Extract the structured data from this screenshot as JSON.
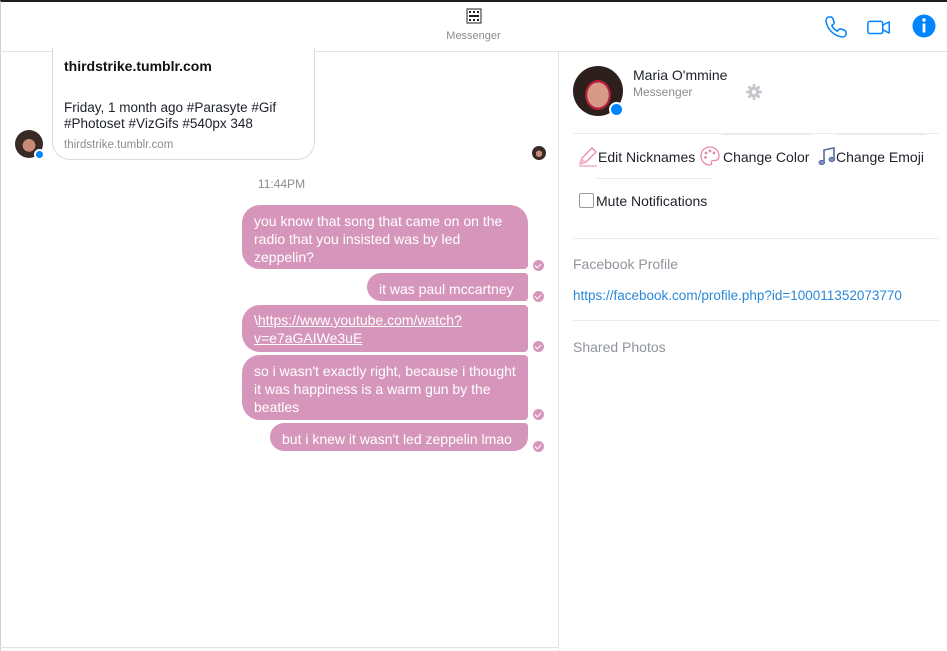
{
  "header": {
    "title": "Messenger",
    "title_icon": "gif-icon",
    "buttons": [
      {
        "name": "call",
        "icon": "phone-icon"
      },
      {
        "name": "video",
        "icon": "video-camera-icon"
      },
      {
        "name": "info",
        "icon": "info-icon"
      }
    ],
    "accent_color": "#0084ff"
  },
  "conversation": {
    "link_preview": {
      "title": "thirdstrike.tumblr.com",
      "description": "Friday, 1 month ago #Parasyte #Gif #Photoset #VizGifs #540px 348",
      "domain": "thirdstrike.tumblr.com"
    },
    "timestamp": "11:44PM",
    "bubble_color": "#d696bb",
    "messages": [
      {
        "text": "you know that song that came on on the radio that you insisted was by led zeppelin?"
      },
      {
        "text": "it was paul mccartney"
      },
      {
        "prefix": "\\",
        "link": "https://www.youtube.com/watch?v=e7aGAIWe3uE"
      },
      {
        "text": "so i wasn't exactly right, because i thought it was happiness is a warm gun by the beatles"
      },
      {
        "text": "but i knew it wasn't led zeppelin lmao"
      }
    ]
  },
  "details": {
    "name": "Maria O'mmine",
    "subtitle": "Messenger",
    "actions": {
      "nicknames": "Edit Nicknames",
      "color": "Change Color",
      "emoji": "Change Emoji",
      "mute": "Mute Notifications"
    },
    "mute_checked": false,
    "facebook_profile": {
      "title": "Facebook Profile",
      "url": "https://facebook.com/profile.php?id=100011352073770"
    },
    "shared_photos_title": "Shared Photos"
  }
}
